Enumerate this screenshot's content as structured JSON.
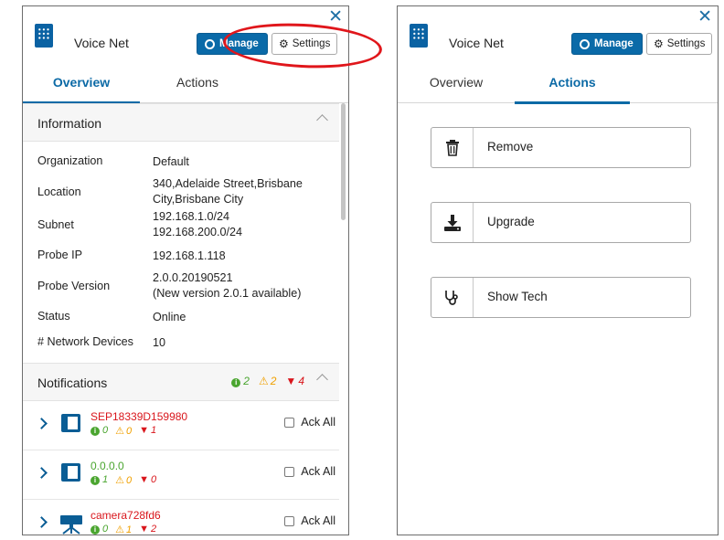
{
  "left": {
    "title": "Voice Net",
    "close": "✕",
    "manage_label": "Manage",
    "settings_label": "Settings",
    "tabs": [
      {
        "label": "Overview",
        "active": true
      },
      {
        "label": "Actions",
        "active": false
      }
    ],
    "information": {
      "header": "Information",
      "rows": [
        {
          "key": "Organization",
          "value": "Default"
        },
        {
          "key": "Location",
          "value_lines": [
            "340,Adelaide Street,Brisbane",
            "City,Brisbane City"
          ]
        },
        {
          "key": "Subnet",
          "value_lines": [
            "192.168.1.0/24",
            "192.168.200.0/24"
          ]
        },
        {
          "key": "Probe IP",
          "value": "192.168.1.118"
        },
        {
          "key": "Probe Version",
          "value_lines": [
            "2.0.0.20190521",
            "(New version 2.0.1 available)"
          ]
        },
        {
          "key": "Status",
          "value": "Online"
        },
        {
          "key": "# Network Devices",
          "value": "10"
        }
      ]
    },
    "notifications": {
      "header": "Notifications",
      "info": "2",
      "warn": "2",
      "crit": "4",
      "items": [
        {
          "name": "SEP18339D159980",
          "name_color": "#d9161c",
          "icon": "phone-icon",
          "info": "0",
          "warn": "0",
          "crit": "1",
          "ack": "Ack All"
        },
        {
          "name": "0.0.0.0",
          "name_color": "#4aa52f",
          "icon": "phone-icon",
          "info": "1",
          "warn": "0",
          "crit": "0",
          "ack": "Ack All"
        },
        {
          "name": "camera728fd6",
          "name_color": "#d9161c",
          "icon": "camera-icon",
          "info": "0",
          "warn": "1",
          "crit": "2",
          "ack": "Ack All"
        }
      ]
    }
  },
  "right": {
    "title": "Voice Net",
    "close": "✕",
    "manage_label": "Manage",
    "settings_label": "Settings",
    "tabs": [
      {
        "label": "Overview",
        "active": false
      },
      {
        "label": "Actions",
        "active": true
      }
    ],
    "actions": [
      {
        "label": "Remove",
        "icon": "trash-icon"
      },
      {
        "label": "Upgrade",
        "icon": "download-icon"
      },
      {
        "label": "Show Tech",
        "icon": "stethoscope-icon"
      }
    ]
  },
  "colors": {
    "brand_blue": "#0a6aa8",
    "highlight_red": "#e0161b",
    "ok_green": "#4aa52f",
    "warn_orange": "#f0a000",
    "crit_red": "#d9161c"
  }
}
